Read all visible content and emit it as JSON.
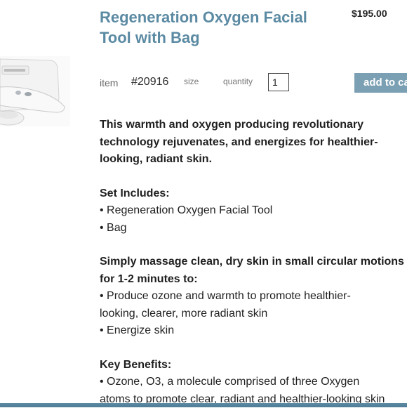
{
  "product": {
    "title_line1": "Regeneration Oxygen Facial",
    "title_line2": "Tool with Bag",
    "price": "$195.00"
  },
  "meta": {
    "item_label": "item",
    "item_number": "#20916",
    "size_label": "size",
    "quantity_label": "quantity",
    "quantity_value": "1",
    "add_to_cart_label": "add to cart"
  },
  "description": {
    "intro": [
      "This warmth and oxygen producing revolutionary",
      "technology rejuvenates, and energizes for healthier-",
      "looking, radiant skin."
    ],
    "set_heading": "Set Includes:",
    "set_items": [
      "• Regeneration Oxygen Facial Tool",
      "• Bag"
    ],
    "usage_heading": [
      "Simply massage clean, dry skin in small circular motions",
      "for 1-2 minutes to:"
    ],
    "usage_items": [
      "• Produce ozone and warmth to promote healthier-",
      "looking, clearer, more radiant skin",
      "• Energize skin"
    ],
    "benefits_heading": "Key Benefits:",
    "benefits_items": [
      "• Ozone, O3, a molecule comprised of three Oxygen",
      "atoms to promote clear, radiant and healthier-looking skin"
    ]
  }
}
